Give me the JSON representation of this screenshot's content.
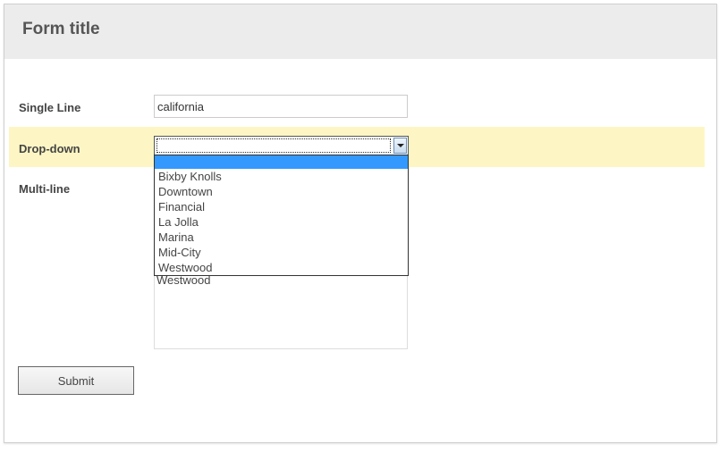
{
  "form": {
    "title": "Form title",
    "submit_label": "Submit"
  },
  "fields": {
    "single_line": {
      "label": "Single Line",
      "value": "california"
    },
    "dropdown": {
      "label": "Drop-down",
      "selected_value": "",
      "options": [
        "",
        "Bixby Knolls",
        "Downtown",
        "Financial",
        "La Jolla",
        "Marina",
        "Mid-City",
        "Westwood"
      ]
    },
    "multi_line": {
      "label": "Multi-line",
      "visible_text": "Westwood"
    }
  },
  "colors": {
    "header_bg": "#ececec",
    "highlight_row": "#fdf6c4",
    "selected_option": "#3399ff"
  }
}
